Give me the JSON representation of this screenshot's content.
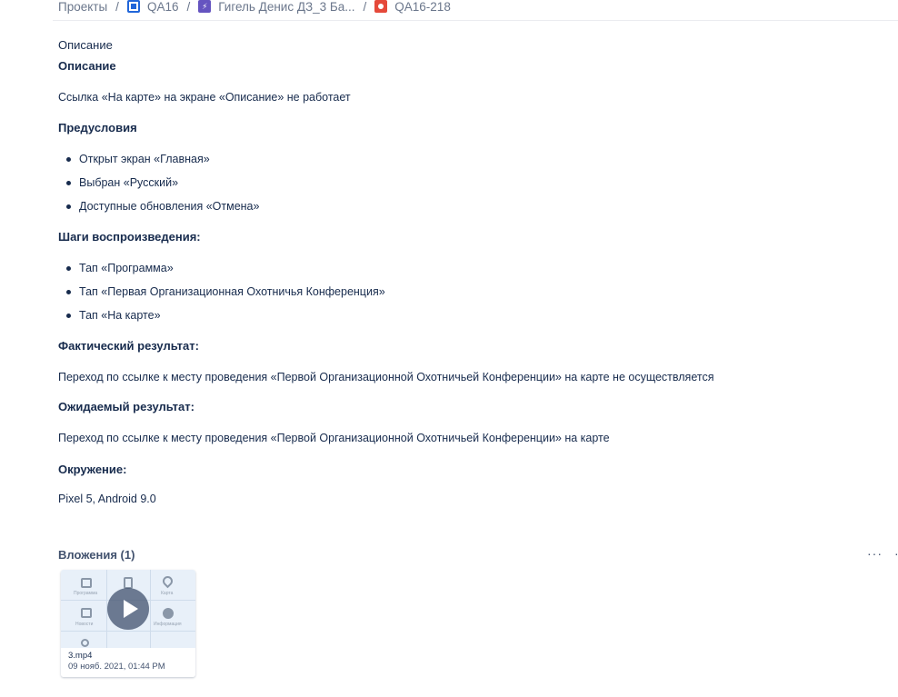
{
  "breadcrumb": {
    "projects": "Проекты",
    "sep": "/",
    "project": "QA16",
    "epic": "Гигель Денис ДЗ_3 Ба...",
    "issue": "QA16-218"
  },
  "description_label": "Описание",
  "description": {
    "h_description": "Описание",
    "summary": "Ссылка «На карте» на экране «Описание» не работает",
    "h_preconditions": "Предусловия",
    "preconditions": [
      "Открыт экран «Главная»",
      "Выбран «Русский»",
      "Доступные обновления «Отмена»"
    ],
    "h_steps": "Шаги воспроизведения:",
    "steps": [
      "Тап «Программа»",
      "Тап «Первая Организационная Охотничья Конференция»",
      "Тап «На карте»"
    ],
    "h_actual": "Фактический результат:",
    "actual": "Переход по ссылке к месту проведения «Первой Организационной Охотничьей Конференции» на карте не осуществляется",
    "h_expected": "Ожидаемый результат:",
    "expected": "Переход по ссылке к месту проведения «Первой Организационной Охотничьей Конференции» на карте",
    "h_environment": "Окружение:",
    "environment": "Pixel 5, Android 9.0"
  },
  "attachments": {
    "title": "Вложения (1)",
    "more": "···",
    "edge": "·",
    "items": [
      {
        "file_name": "3.mp4",
        "date": "09 нояб. 2021, 01:44 PM",
        "preview_labels": [
          "Программа",
          "Карта",
          "Новости",
          "Информация"
        ]
      }
    ]
  },
  "colors": {
    "text": "#172b4d",
    "muted": "#6b778c",
    "epic": "#6554c0",
    "bug": "#e5493a",
    "project": "#2166d9"
  },
  "icons": {
    "project": "project-avatar-icon",
    "epic": "epic-lightning-icon",
    "issue": "bug-icon",
    "play": "play-icon",
    "more": "more-dots-icon"
  }
}
